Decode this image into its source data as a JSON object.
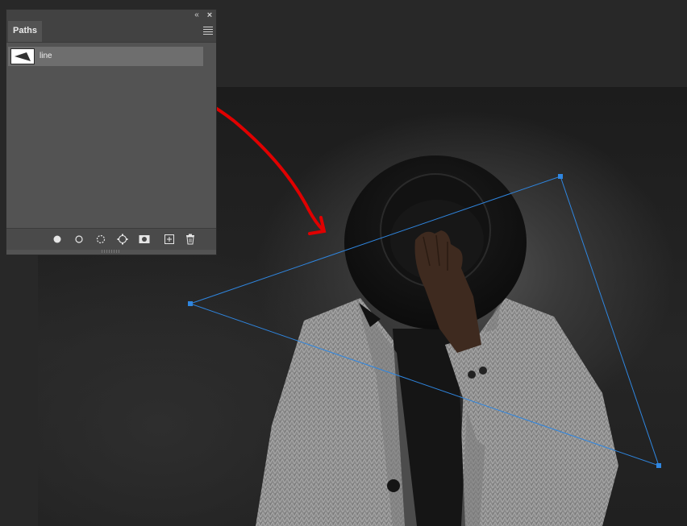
{
  "panel": {
    "collapse_icon": "double-chevron-left-icon",
    "close_icon": "close-icon",
    "tab_label": "Paths",
    "menu_icon": "panel-menu-icon",
    "paths": [
      {
        "name": "line",
        "thumbnail_icon": "path-thumbnail-icon"
      }
    ],
    "footer_buttons": [
      {
        "icon": "fill-path-icon"
      },
      {
        "icon": "stroke-path-icon"
      },
      {
        "icon": "load-path-as-selection-icon"
      },
      {
        "icon": "make-work-path-icon"
      },
      {
        "icon": "add-mask-icon"
      },
      {
        "icon": "new-path-icon"
      },
      {
        "icon": "delete-path-icon"
      }
    ]
  },
  "colors": {
    "path_stroke": "#2f86e0",
    "annotation_red": "#e00000",
    "panel_bg": "#535353",
    "workspace_bg": "#282828"
  }
}
